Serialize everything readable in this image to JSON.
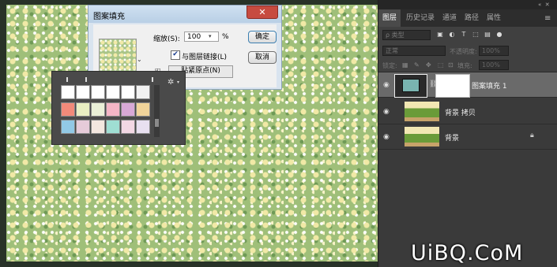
{
  "dialog": {
    "title": "图案填充",
    "close_label": "✕",
    "scale_label": "缩放(S):",
    "scale_value": "100",
    "scale_unit": "%",
    "link_label": "与图层链接(L)",
    "link_checked": true,
    "snap_label": "贴紧原点(N)",
    "ok_label": "确定",
    "cancel_label": "取消"
  },
  "picker": {
    "swatch_colors": [
      "#ffffff",
      "#ffffff",
      "#ffffff",
      "#ffffff",
      "#ffffff",
      "#f2f2f2",
      "#f28a7a",
      "#e9eec2",
      "#eaf0d8",
      "#f4b5c6",
      "#d8a9d6",
      "#f1d49a",
      "#92c9e6",
      "#e6cbd9",
      "#f4e7e0",
      "#9fded3",
      "#f3d8e4",
      "#e8e0f0"
    ]
  },
  "panel": {
    "tabs": [
      "图层",
      "历史记录",
      "通道",
      "路径",
      "属性"
    ],
    "active_tab": "图层",
    "kind_select": "ρ 类型",
    "blend_mode": "正常",
    "opacity_label": "不透明度:",
    "opacity_value": "100%",
    "lock_label": "锁定:",
    "fill_label": "填充:",
    "fill_value": "100%"
  },
  "layers": [
    {
      "name": "图案填充 1",
      "selected": true,
      "locked": false
    },
    {
      "name": "背景 拷贝",
      "selected": false,
      "locked": false
    },
    {
      "name": "背景",
      "selected": false,
      "locked": true
    }
  ],
  "watermark": "UiBQ.CoM",
  "colors": {
    "pattern_green": "#9fbf79",
    "pattern_flower": "#f1e9a6",
    "panel_bg": "#3a3a3a",
    "selected_layer": "#6a6a6a",
    "dialog_close": "#c74b40"
  },
  "icons": {
    "eye": "eye-icon",
    "chain": "link-icon",
    "lock": "lock-icon",
    "gear": "gear-icon",
    "search": "search-icon"
  }
}
